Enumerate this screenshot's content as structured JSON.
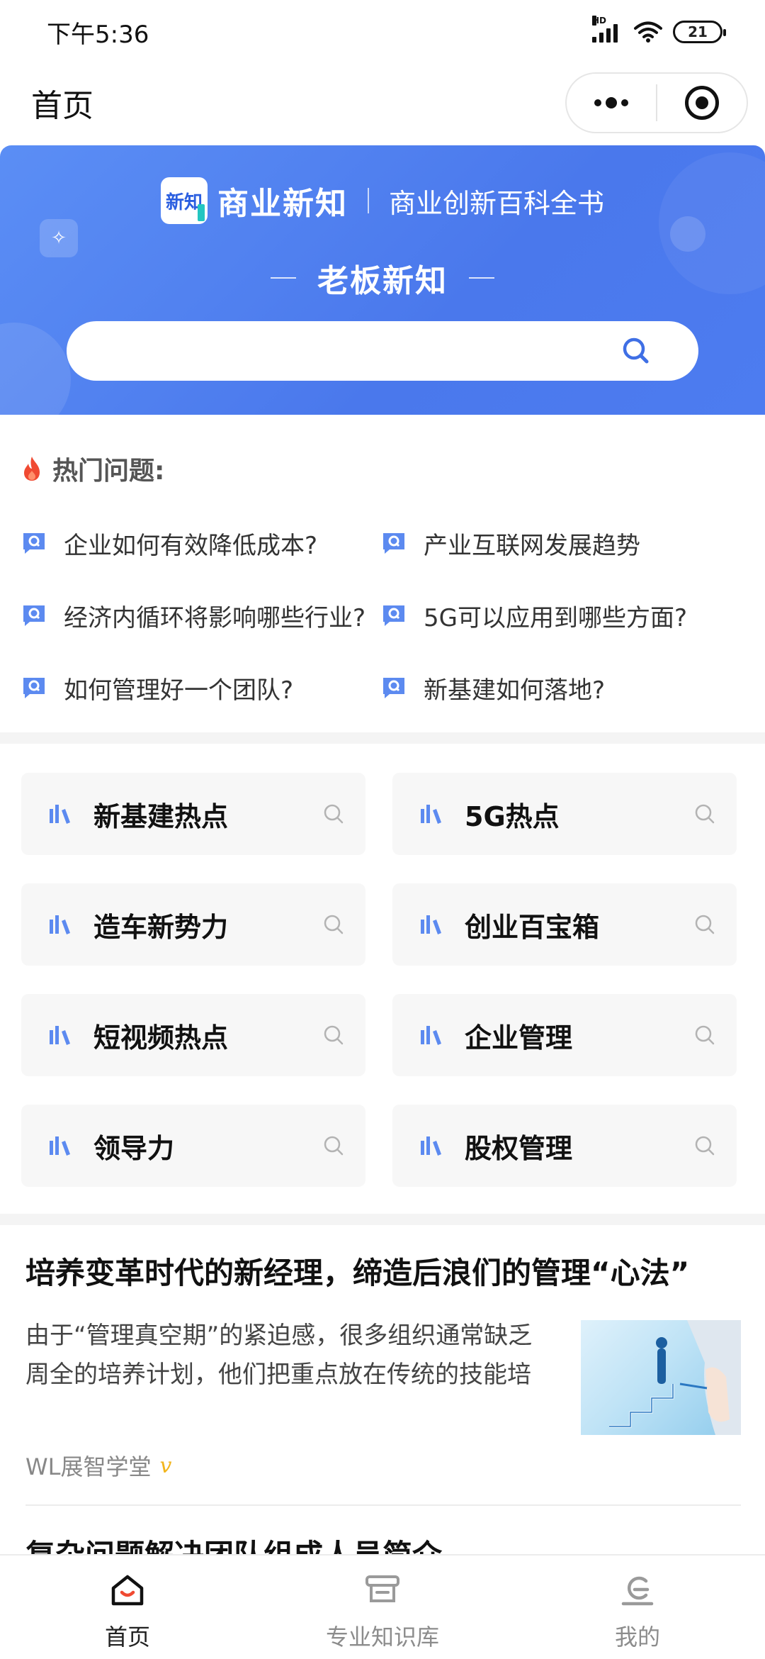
{
  "status_bar": {
    "time": "下午5:36",
    "network": "HD",
    "battery": "21"
  },
  "nav": {
    "title": "首页"
  },
  "banner": {
    "logo_text": "新知",
    "brand_name": "商业新知",
    "slogan": "商业创新百科全书",
    "subtitle": "老板新知",
    "search_placeholder": ""
  },
  "hot": {
    "title": "热门问题:",
    "questions": [
      "企业如何有效降低成本?",
      "产业互联网发展趋势",
      "经济内循环将影响哪些行业?",
      "5G可以应用到哪些方面?",
      "如何管理好一个团队?",
      "新基建如何落地?"
    ]
  },
  "topics": [
    "新基建热点",
    "5G热点",
    "造车新势力",
    "创业百宝箱",
    "短视频热点",
    "企业管理",
    "领导力",
    "股权管理"
  ],
  "article": {
    "title": "培养变革时代的新经理，缔造后浪们的管理“心法”",
    "desc": "由于“管理真空期”的紧迫感，很多组织通常缺乏周全的培养计划，他们把重点放在传统的技能培训上",
    "author": "WL展智学堂",
    "verified": "v"
  },
  "article2": {
    "title": "复杂问题解决团队组成人员简介"
  },
  "tabbar": {
    "home": "首页",
    "library": "专业知识库",
    "mine": "我的"
  },
  "colors": {
    "primary": "#4a78ec",
    "accent_teal": "#23c6c1",
    "flame": "#f04a32"
  }
}
